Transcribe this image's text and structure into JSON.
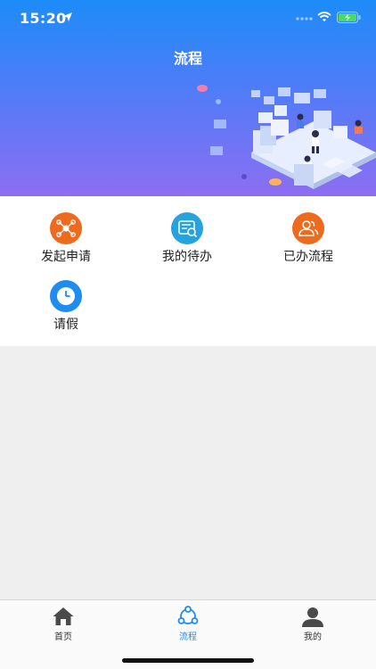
{
  "status_bar": {
    "time": "15:20"
  },
  "header": {
    "title": "流程"
  },
  "menu": {
    "items": [
      {
        "label": "发起申请",
        "icon": "network-icon",
        "color": "#ee6a1c"
      },
      {
        "label": "我的待办",
        "icon": "document-search-icon",
        "color": "#26a3dd"
      },
      {
        "label": "已办流程",
        "icon": "users-icon",
        "color": "#ee6a1c"
      },
      {
        "label": "请假",
        "icon": "clock-icon",
        "color": "#1e8cf0"
      }
    ]
  },
  "tabbar": {
    "tabs": [
      {
        "label": "首页",
        "icon": "home-icon"
      },
      {
        "label": "流程",
        "icon": "workflow-icon",
        "active": true
      },
      {
        "label": "我的",
        "icon": "person-icon"
      }
    ]
  },
  "colors": {
    "header_gradient_start": "#1d8cf8",
    "header_gradient_end": "#8d6ef2",
    "active_tab": "#1e8cf0"
  }
}
